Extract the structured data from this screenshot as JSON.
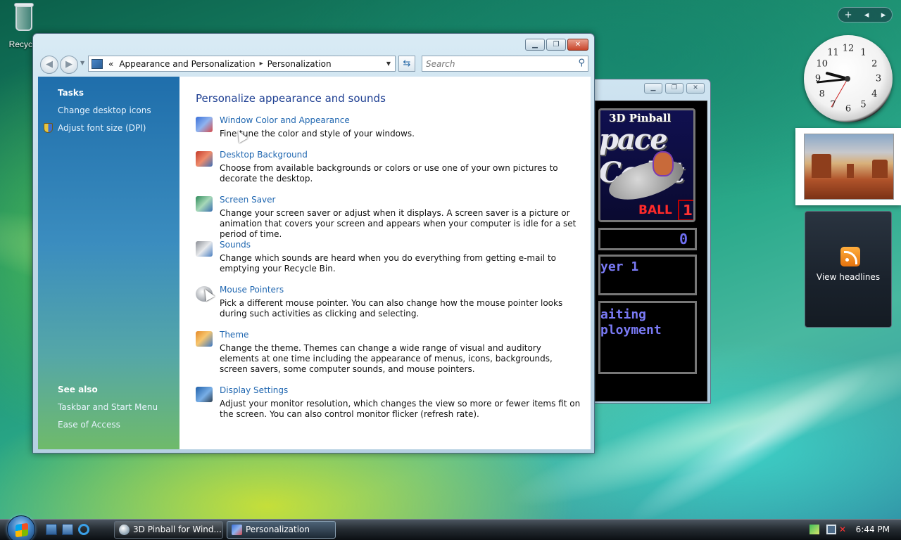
{
  "desktop": {
    "recycle_bin_label": "Recycle"
  },
  "window": {
    "title": "Personalization",
    "controls": {
      "minimize": "▁",
      "maximize": "❐",
      "close": "✕"
    },
    "breadcrumb": {
      "prefix": "«",
      "items": [
        "Appearance and Personalization",
        "Personalization"
      ],
      "separator": "▸"
    },
    "search_placeholder": "Search",
    "sidebar": {
      "tasks_header": "Tasks",
      "tasks": [
        "Change desktop icons",
        "Adjust font size (DPI)"
      ],
      "see_also_header": "See also",
      "see_also": [
        "Taskbar and Start Menu",
        "Ease of Access"
      ]
    },
    "content": {
      "heading": "Personalize appearance and sounds",
      "items": [
        {
          "title": "Window Color and Appearance",
          "desc": "Fine tune the color and style of your windows.",
          "icon": "window-color-icon"
        },
        {
          "title": "Desktop Background",
          "desc": "Choose from available backgrounds or colors or use one of your own pictures to decorate the desktop.",
          "icon": "desktop-background-icon"
        },
        {
          "title": "Screen Saver",
          "desc": "Change your screen saver or adjust when it displays. A screen saver is a picture or animation that covers your screen and appears when your computer is idle for a set period of time.",
          "icon": "screen-saver-icon"
        },
        {
          "title": "Sounds",
          "desc": "Change which sounds are heard when you do everything from getting e-mail to emptying your Recycle Bin.",
          "icon": "sounds-icon"
        },
        {
          "title": "Mouse Pointers",
          "desc": "Pick a different mouse pointer. You can also change how the mouse pointer looks during such activities as clicking and selecting.",
          "icon": "mouse-pointers-icon"
        },
        {
          "title": "Theme",
          "desc": "Change the theme. Themes can change a wide range of visual and auditory elements at one time including the appearance of menus, icons, backgrounds, screen savers, some computer sounds, and mouse pointers.",
          "icon": "theme-icon"
        },
        {
          "title": "Display Settings",
          "desc": "Adjust your monitor resolution, which changes the view so more or fewer items fit on the screen. You can also control monitor flicker (refresh rate).",
          "icon": "display-settings-icon"
        }
      ]
    }
  },
  "pinball": {
    "title_small": "3D Pinball",
    "title_big": "pace Cadet",
    "ball_label": "BALL",
    "ball_number": "1",
    "score": "0",
    "player": "yer 1",
    "message": "aiting\nployment"
  },
  "gadgets": {
    "top_controls": [
      "+",
      "◂",
      "▸"
    ],
    "clock_numbers": [
      "12",
      "1",
      "2",
      "3",
      "4",
      "5",
      "6",
      "7",
      "8",
      "9",
      "10",
      "11"
    ],
    "feed_label": "View headlines"
  },
  "taskbar": {
    "buttons": [
      {
        "label": "3D Pinball for Wind...",
        "active": false
      },
      {
        "label": "Personalization",
        "active": true
      }
    ],
    "time": "6:44 PM"
  },
  "colors": {
    "link": "#1f66b0",
    "heading": "#1e3f92",
    "sidebar_top": "#1f6eab",
    "sidebar_bottom": "#6fba6a"
  }
}
